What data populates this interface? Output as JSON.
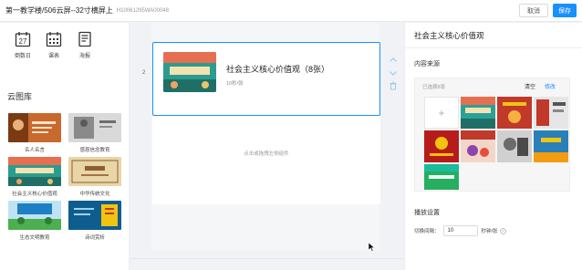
{
  "header": {
    "title": "第一教学楼/506云屏--32寸横屏上",
    "device_id": "H10061295WA00048",
    "cancel_label": "取消",
    "save_label": "保存"
  },
  "widgets": [
    {
      "label": "倒数日",
      "icon": "calendar-27-icon"
    },
    {
      "label": "课表",
      "icon": "timetable-icon"
    },
    {
      "label": "海报",
      "icon": "poster-icon"
    }
  ],
  "library": {
    "title": "云图库",
    "items": [
      {
        "label": "名人名言",
        "color": "#c8692d"
      },
      {
        "label": "感恩信念教育",
        "color": "#9a9a9a"
      },
      {
        "label": "社会主义核心价值观",
        "color": "#2a9d8f"
      },
      {
        "label": "中华传统文化",
        "color": "#d6c089"
      },
      {
        "label": "生态文明教育",
        "color": "#1e7fc4"
      },
      {
        "label": "诗词赏析",
        "color": "#0f5d8f"
      }
    ]
  },
  "canvas": {
    "row_index": "2",
    "selected_slot": {
      "title": "社会主义核心价值观（8张）",
      "subtitle": "10秒/张"
    },
    "empty_slot_hint": "点击或拖拽左侧组件"
  },
  "panel": {
    "title": "社会主义核心价值观",
    "content_source_label": "内容来源",
    "selected_label": "已选择8张",
    "clear_label": "清空",
    "edit_label": "修改",
    "playback_label": "播放设置",
    "switch_interval_label": "切换间隔：",
    "switch_interval_value": "10",
    "switch_interval_unit": "秒钟/张"
  },
  "source_images": [
    {
      "color": "#2aa198"
    },
    {
      "color": "#c0392b"
    },
    {
      "color": "#e0e0e0"
    },
    {
      "color": "#c0392b"
    },
    {
      "color": "#b03a2e"
    },
    {
      "color": "#8e8e8e"
    },
    {
      "color": "#2980b9"
    },
    {
      "color": "#27ae60"
    }
  ],
  "colors": {
    "accent": "#1890ff"
  }
}
